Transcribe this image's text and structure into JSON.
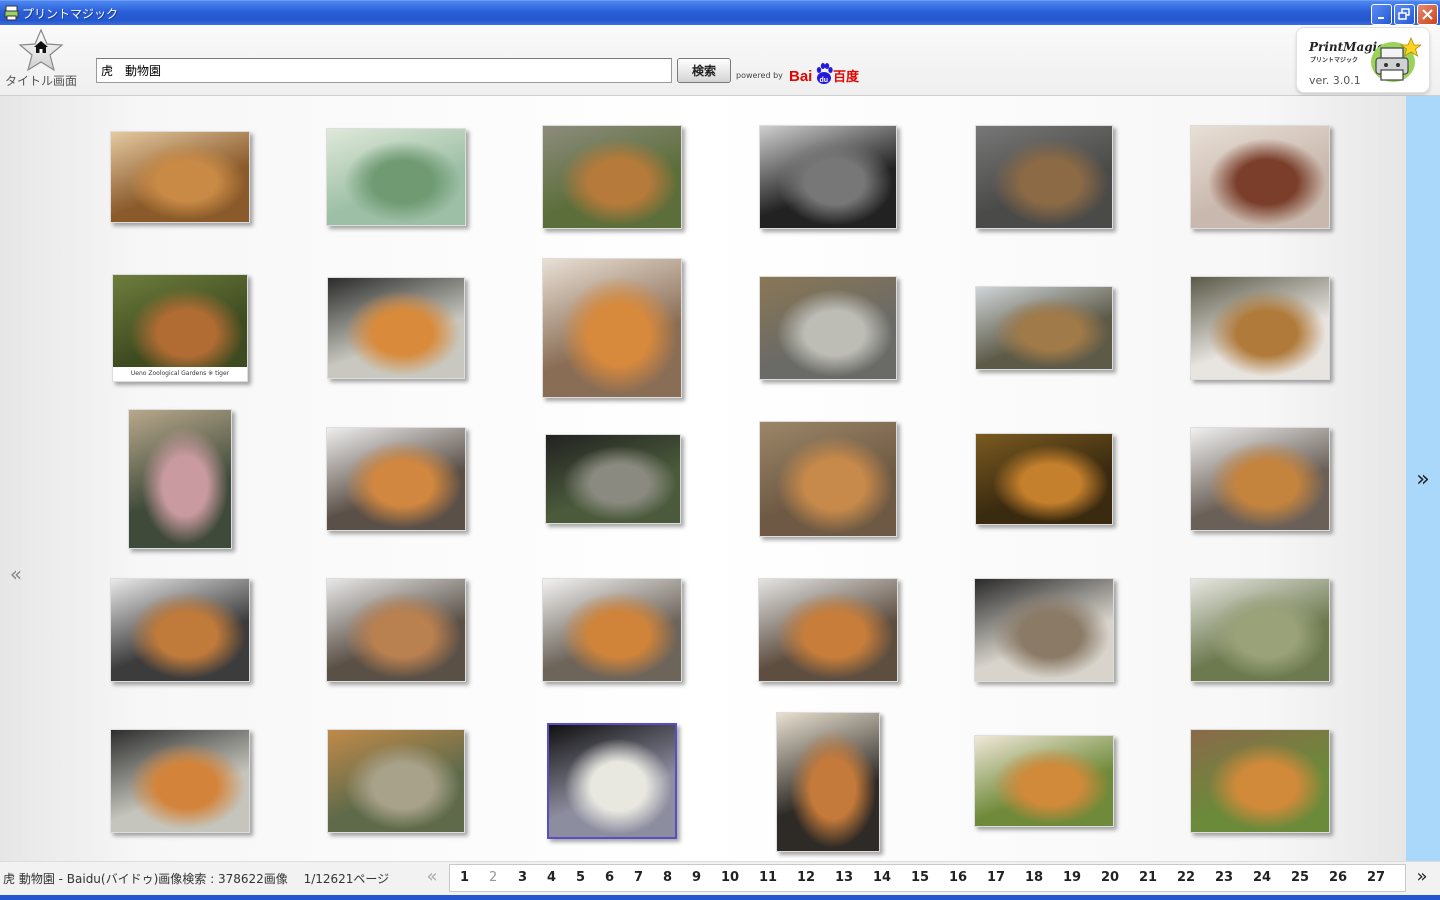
{
  "window": {
    "title": "プリントマジック"
  },
  "toolbar": {
    "home_label": "タイトル画面",
    "search_value": "虎　動物園",
    "search_button": "検索",
    "powered_by": "powered by",
    "baidu_logo_text": "Bai百度",
    "brand_name": "PrintMagic",
    "brand_sub": "プリントマジック",
    "version": "ver. 3.0.1"
  },
  "gallery": {
    "prev_arrow": "«",
    "next_arrow": "»",
    "thumbnails": [
      {
        "row": 1,
        "col": 1,
        "subject": "tiger behind wire",
        "colors": [
          "#8a5a2a",
          "#c98a45",
          "#e5c9a0"
        ]
      },
      {
        "row": 1,
        "col": 2,
        "subject": "green enclosure",
        "colors": [
          "#9dbfa6",
          "#6f9a72",
          "#dfe9d9"
        ]
      },
      {
        "row": 1,
        "col": 3,
        "subject": "tiger walking on rocks",
        "colors": [
          "#5c6e3a",
          "#b67a3a",
          "#8c8c7c"
        ]
      },
      {
        "row": 1,
        "col": 4,
        "subject": "black and white enclosure",
        "colors": [
          "#222",
          "#777",
          "#cfcfcf"
        ]
      },
      {
        "row": 1,
        "col": 5,
        "subject": "tiger by rock wall",
        "colors": [
          "#4a4a48",
          "#8b6a45",
          "#777"
        ]
      },
      {
        "row": 1,
        "col": 6,
        "subject": "red pandas",
        "colors": [
          "#c9b8ad",
          "#7a3e2a",
          "#e8dfd6"
        ]
      },
      {
        "row": 2,
        "col": 1,
        "subject": "Ueno Zoological Gardens tiger",
        "caption": "Ueno Zoological Gardens ※ tiger",
        "colors": [
          "#3e4a20",
          "#b06c33",
          "#6d7d3c"
        ]
      },
      {
        "row": 2,
        "col": 2,
        "subject": "tiger face lying",
        "colors": [
          "#c8c8c0",
          "#d98a3a",
          "#2b2b2b"
        ]
      },
      {
        "row": 2,
        "col": 3,
        "subject": "tiger close-up profile",
        "colors": [
          "#8a6d55",
          "#d88a3c",
          "#e9e0d5"
        ]
      },
      {
        "row": 2,
        "col": 4,
        "subject": "tiger lying in cage",
        "colors": [
          "#6a6a66",
          "#bdbdb6",
          "#8a7755"
        ]
      },
      {
        "row": 2,
        "col": 5,
        "subject": "tiger walking in pen",
        "colors": [
          "#5d5a48",
          "#a07a48",
          "#cfd5d8"
        ]
      },
      {
        "row": 2,
        "col": 6,
        "subject": "tiger statue sign",
        "colors": [
          "#e8e4e0",
          "#b07a3a",
          "#5a5a48"
        ]
      },
      {
        "row": 3,
        "col": 1,
        "subject": "child on tiger statue",
        "colors": [
          "#3f4a3a",
          "#c99aa0",
          "#b8a88c"
        ]
      },
      {
        "row": 3,
        "col": 2,
        "subject": "tiger in snow",
        "colors": [
          "#5b5048",
          "#d1873f",
          "#eeeeee"
        ]
      },
      {
        "row": 3,
        "col": 3,
        "subject": "tiger among plants",
        "colors": [
          "#4a5a3a",
          "#8a8a80",
          "#222"
        ]
      },
      {
        "row": 3,
        "col": 4,
        "subject": "tiger lying on ground",
        "colors": [
          "#6e5a44",
          "#c88a4a",
          "#9c8668"
        ]
      },
      {
        "row": 3,
        "col": 5,
        "subject": "tiger in dark enclosure",
        "colors": [
          "#3a2a10",
          "#c4802c",
          "#7a5a20"
        ]
      },
      {
        "row": 3,
        "col": 6,
        "subject": "tiger in snow",
        "colors": [
          "#6a6058",
          "#c5843e",
          "#f0f0f0"
        ]
      },
      {
        "row": 4,
        "col": 1,
        "subject": "tiger in snowy cave",
        "colors": [
          "#3c3c3c",
          "#c07a3a",
          "#e9e9e9"
        ]
      },
      {
        "row": 4,
        "col": 2,
        "subject": "tiger walking in snow",
        "colors": [
          "#5a5046",
          "#b98050",
          "#e8e8e8"
        ]
      },
      {
        "row": 4,
        "col": 3,
        "subject": "tiger in snow",
        "colors": [
          "#6d645a",
          "#d0843a",
          "#f2f2f2"
        ]
      },
      {
        "row": 4,
        "col": 4,
        "subject": "tiger standing in snow",
        "colors": [
          "#5e4e40",
          "#c87e3a",
          "#e4e4e4"
        ]
      },
      {
        "row": 4,
        "col": 5,
        "subject": "pale tiger face",
        "colors": [
          "#d8d4cc",
          "#8a7a66",
          "#2a2a2a"
        ]
      },
      {
        "row": 4,
        "col": 6,
        "subject": "white tiger on grass",
        "colors": [
          "#6d7a50",
          "#9aa27a",
          "#e6e6e0"
        ]
      },
      {
        "row": 5,
        "col": 1,
        "subject": "tiger face lying",
        "colors": [
          "#c5c5bd",
          "#d4843a",
          "#2e2e2e"
        ]
      },
      {
        "row": 5,
        "col": 2,
        "subject": "tiger behind bars",
        "colors": [
          "#5e6a4a",
          "#a9a28a",
          "#c08a4a"
        ]
      },
      {
        "row": 5,
        "col": 3,
        "subject": "crystal beads",
        "colors": [
          "#8d8da0",
          "#e8e8e0",
          "#111"
        ]
      },
      {
        "row": 5,
        "col": 4,
        "subject": "tiger sitting portrait",
        "colors": [
          "#2e2a26",
          "#c47a3a",
          "#e8e0d0"
        ]
      },
      {
        "row": 5,
        "col": 5,
        "subject": "tiger face in grass",
        "colors": [
          "#6f8a3a",
          "#d08a3a",
          "#f0e8d8"
        ]
      },
      {
        "row": 5,
        "col": 6,
        "subject": "tiger and child by fence",
        "colors": [
          "#6b8a3a",
          "#d08a3a",
          "#8a6a4a"
        ]
      }
    ]
  },
  "bottom": {
    "status": "虎 動物園 - Baidu(バイドゥ)画像検索 : 378622画像　 1/12621ページ",
    "prev_arrow": "«",
    "next_arrow": "»",
    "pages": [
      "1",
      "2",
      "3",
      "4",
      "5",
      "6",
      "7",
      "8",
      "9",
      "10",
      "11",
      "12",
      "13",
      "14",
      "15",
      "16",
      "17",
      "18",
      "19",
      "20",
      "21",
      "22",
      "23",
      "24",
      "25",
      "26",
      "27"
    ],
    "current_page": "2"
  }
}
